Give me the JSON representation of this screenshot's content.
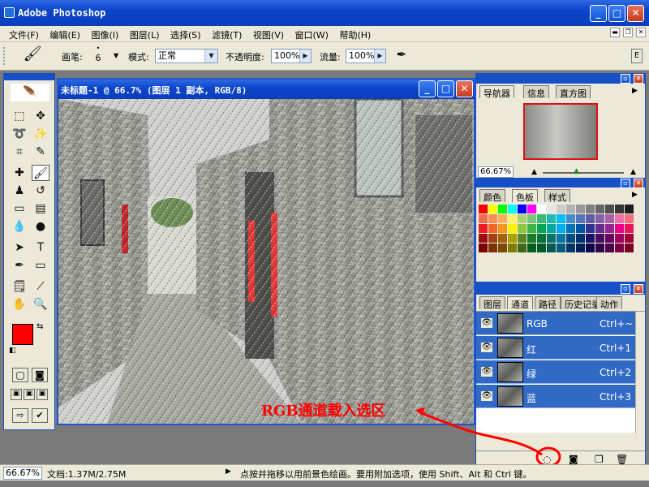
{
  "app": {
    "title": "Adobe Photoshop"
  },
  "menu": {
    "items": [
      "文件(F)",
      "编辑(E)",
      "图像(I)",
      "图层(L)",
      "选择(S)",
      "滤镜(T)",
      "视图(V)",
      "窗口(W)",
      "帮助(H)"
    ]
  },
  "options": {
    "brush_label": "画笔:",
    "brush_size": "6",
    "mode_label": "模式:",
    "mode_value": "正常",
    "opacity_label": "不透明度:",
    "opacity_value": "100%",
    "flow_label": "流量:",
    "flow_value": "100%"
  },
  "document": {
    "title": "未标题-1 @ 66.7% (图层 1 副本, RGB/8)"
  },
  "navigator_panel": {
    "tabs": [
      "导航器",
      "信息",
      "直方图"
    ],
    "zoom": "66.67%"
  },
  "color_panel": {
    "tabs": [
      "颜色",
      "色板",
      "样式"
    ],
    "swatches": [
      [
        "#ff0000",
        "#ffff00",
        "#00ff00",
        "#00ffff",
        "#0000ff",
        "#ff00ff",
        "#ffffff",
        "#e6e6e6",
        "#cccccc",
        "#b3b3b3",
        "#999999",
        "#808080",
        "#666666",
        "#4d4d4d",
        "#333333",
        "#1a1a1a"
      ],
      [
        "#f26c4f",
        "#f68e55",
        "#fbaf5c",
        "#fff467",
        "#acd372",
        "#7cc576",
        "#3bb878",
        "#1abbb4",
        "#00bff3",
        "#438ccb",
        "#5574b9",
        "#605ca8",
        "#855fa8",
        "#a763a9",
        "#f06eaa",
        "#f26d7d"
      ],
      [
        "#ed1c24",
        "#f26522",
        "#f7941d",
        "#fff200",
        "#8dc63f",
        "#39b54a",
        "#00a651",
        "#00a99d",
        "#00aeef",
        "#0072bc",
        "#0054a6",
        "#2e3192",
        "#662d91",
        "#92278f",
        "#ec008c",
        "#ed145b"
      ],
      [
        "#9e0b0f",
        "#a0410d",
        "#a36209",
        "#aba000",
        "#598527",
        "#1a7b30",
        "#007236",
        "#00746b",
        "#0076a3",
        "#004b80",
        "#003471",
        "#1b1464",
        "#440e62",
        "#630460",
        "#9e005d",
        "#9e0039"
      ],
      [
        "#790000",
        "#7b2e00",
        "#7d4900",
        "#827b00",
        "#406618",
        "#005e20",
        "#005826",
        "#005952",
        "#005b7f",
        "#003663",
        "#002157",
        "#0d004c",
        "#32004b",
        "#4b0049",
        "#7b0046",
        "#7a0026"
      ]
    ]
  },
  "layers_panel": {
    "tabs": [
      "图层",
      "通道",
      "路径",
      "历史记录",
      "动作"
    ],
    "channels": [
      {
        "name": "RGB",
        "shortcut": "Ctrl+~"
      },
      {
        "name": "红",
        "shortcut": "Ctrl+1"
      },
      {
        "name": "绿",
        "shortcut": "Ctrl+2"
      },
      {
        "name": "蓝",
        "shortcut": "Ctrl+3"
      }
    ]
  },
  "status": {
    "zoom": "66.67%",
    "doc_info": "文档:1.37M/2.75M",
    "hint": "点按并拖移以用前景色绘画。要用附加选项，使用 Shift、Alt 和 Ctrl 键。"
  },
  "annotation": {
    "text": "RGB通道载入选区"
  },
  "colors": {
    "foreground": "#ff0000",
    "background": "#ffffff",
    "annotation": "#ff0000",
    "titlebar": "#0c44c9"
  }
}
